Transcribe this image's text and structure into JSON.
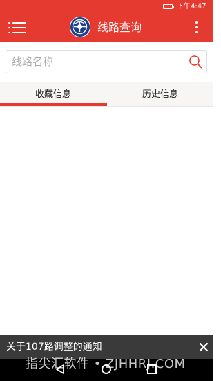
{
  "status_bar": {
    "time": "下午4:47"
  },
  "app_bar": {
    "title": "线路查询"
  },
  "search": {
    "placeholder": "线路名称",
    "value": ""
  },
  "tabs": [
    {
      "label": "收藏信息",
      "selected": true
    },
    {
      "label": "历史信息",
      "selected": false
    }
  ],
  "notice": {
    "text": "关于107路调整的通知"
  },
  "watermark": {
    "text": "指尖汇软件 • ZJHHRJ.COM"
  },
  "colors": {
    "primary": "#e53a30",
    "notice_bg": "#3a3a3a",
    "logo_blue": "#1b3f8f"
  },
  "icons": {
    "menu": "menu-icon",
    "more": "more-vertical-icon",
    "search": "search-icon",
    "close": "close-icon",
    "back": "back-icon",
    "home": "home-icon",
    "recent": "recent-apps-icon"
  }
}
